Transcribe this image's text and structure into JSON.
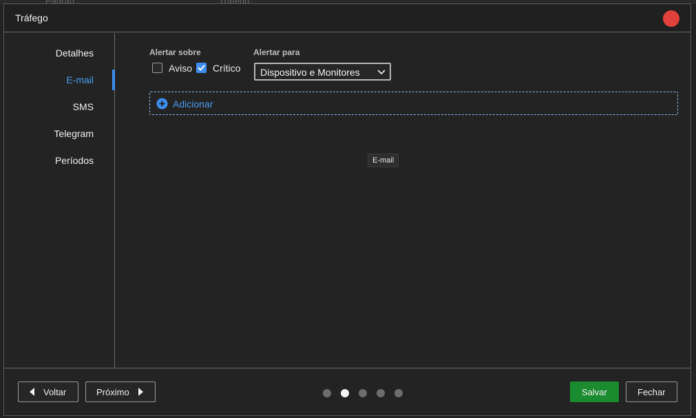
{
  "background": {
    "left_text": "Padrão",
    "right_text": "Tráfego"
  },
  "dialog": {
    "title": "Tráfego"
  },
  "sidebar": {
    "items": [
      {
        "label": "Detalhes",
        "active": false
      },
      {
        "label": "E-mail",
        "active": true
      },
      {
        "label": "SMS",
        "active": false
      },
      {
        "label": "Telegram",
        "active": false
      },
      {
        "label": "Períodos",
        "active": false
      }
    ]
  },
  "email": {
    "alert_about_label": "Alertar sobre",
    "warning_label": "Aviso",
    "warning_checked": false,
    "critical_label": "Crítico",
    "critical_checked": true,
    "alert_to_label": "Alertar para",
    "alert_to_value": "Dispositivo e Monitores",
    "add_label": "Adicionar",
    "tooltip": "E-mail"
  },
  "footer": {
    "back_label": "Voltar",
    "next_label": "Próximo",
    "save_label": "Salvar",
    "close_label": "Fechar",
    "page_count": 5,
    "current_page": 2
  },
  "colors": {
    "accent": "#3d8ef0",
    "save": "#1a8b2e",
    "close_dot": "#e2403a"
  }
}
